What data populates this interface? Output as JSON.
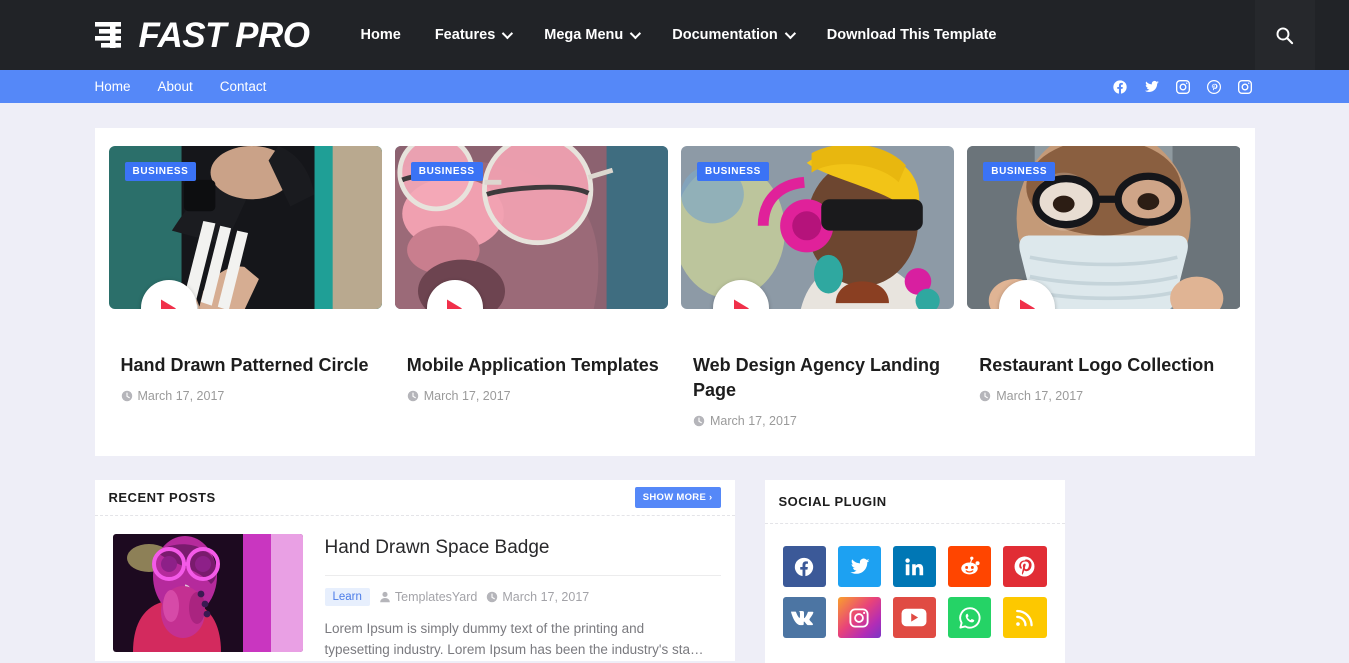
{
  "header": {
    "logo_text": "FAST PRO",
    "logo_icon": "fast-lines-icon",
    "search_icon": "search-icon",
    "nav": [
      {
        "label": "Home",
        "has_caret": false
      },
      {
        "label": "Features",
        "has_caret": true
      },
      {
        "label": "Mega Menu",
        "has_caret": true
      },
      {
        "label": "Documentation",
        "has_caret": true
      },
      {
        "label": "Download This Template",
        "has_caret": false
      }
    ]
  },
  "subbar": {
    "bg_color": "#5588f8",
    "nav": [
      {
        "label": "Home"
      },
      {
        "label": "About"
      },
      {
        "label": "Contact"
      }
    ],
    "social": [
      {
        "icon": "facebook-icon"
      },
      {
        "icon": "twitter-icon"
      },
      {
        "icon": "instagram-icon"
      },
      {
        "icon": "pinterest-icon"
      },
      {
        "icon": "instagram-icon"
      }
    ]
  },
  "featured": {
    "cards": [
      {
        "badge": "BUSINESS",
        "title": "Hand Drawn Patterned Circle",
        "date": "March 17, 2017",
        "date_icon": "clock-icon",
        "play_icon": "play-icon",
        "image_alt": "person-in-black-jacket-writing"
      },
      {
        "badge": "BUSINESS",
        "title": "Mobile Application Templates",
        "date": "March 17, 2017",
        "date_icon": "clock-icon",
        "play_icon": "play-icon",
        "image_alt": "face-with-pink-round-sunglasses"
      },
      {
        "badge": "BUSINESS",
        "title": "Web Design Agency Landing Page",
        "date": "March 17, 2017",
        "date_icon": "clock-icon",
        "play_icon": "play-icon",
        "image_alt": "smiling-woman-pink-headphones-yellow-headwrap"
      },
      {
        "badge": "BUSINESS",
        "title": "Restaurant Logo Collection",
        "date": "March 17, 2017",
        "date_icon": "clock-icon",
        "play_icon": "play-icon",
        "image_alt": "person-wearing-face-mask-and-glasses"
      }
    ]
  },
  "recent_posts": {
    "title": "RECENT POSTS",
    "show_more_label": "SHOW MORE ›",
    "accent_color": "#5588f8",
    "posts": [
      {
        "title": "Hand Drawn Space Badge",
        "tag": "Learn",
        "author": "TemplatesYard",
        "author_icon": "user-icon",
        "date": "March 17, 2017",
        "date_icon": "clock-icon",
        "excerpt": "Lorem Ipsum is simply dummy text of the printing and typesetting industry. Lorem Ipsum has been the industry's sta…",
        "image_alt": "neon-pink-portrait-with-round-glasses"
      }
    ]
  },
  "social_plugin": {
    "title": "SOCIAL PLUGIN",
    "items": [
      {
        "icon": "facebook-icon",
        "color": "#3b5998"
      },
      {
        "icon": "twitter-icon",
        "color": "#1da1f2"
      },
      {
        "icon": "linkedin-icon",
        "color": "#0077b5"
      },
      {
        "icon": "reddit-icon",
        "color": "#ff4500"
      },
      {
        "icon": "pinterest-icon",
        "color": "#e12d35"
      },
      {
        "icon": "vk-icon",
        "color": "#4c75a3"
      },
      {
        "icon": "instagram-icon",
        "color": "#d6249f"
      },
      {
        "icon": "youtube-icon",
        "color": "#e04b43"
      },
      {
        "icon": "whatsapp-icon",
        "color": "#25d366"
      },
      {
        "icon": "rss-icon",
        "color": "#fdc800"
      }
    ]
  },
  "theme": {
    "page_bg": "#eeeef7",
    "header_bg": "#212327",
    "accent": "#5588f8",
    "play_red": "#f0304a"
  }
}
